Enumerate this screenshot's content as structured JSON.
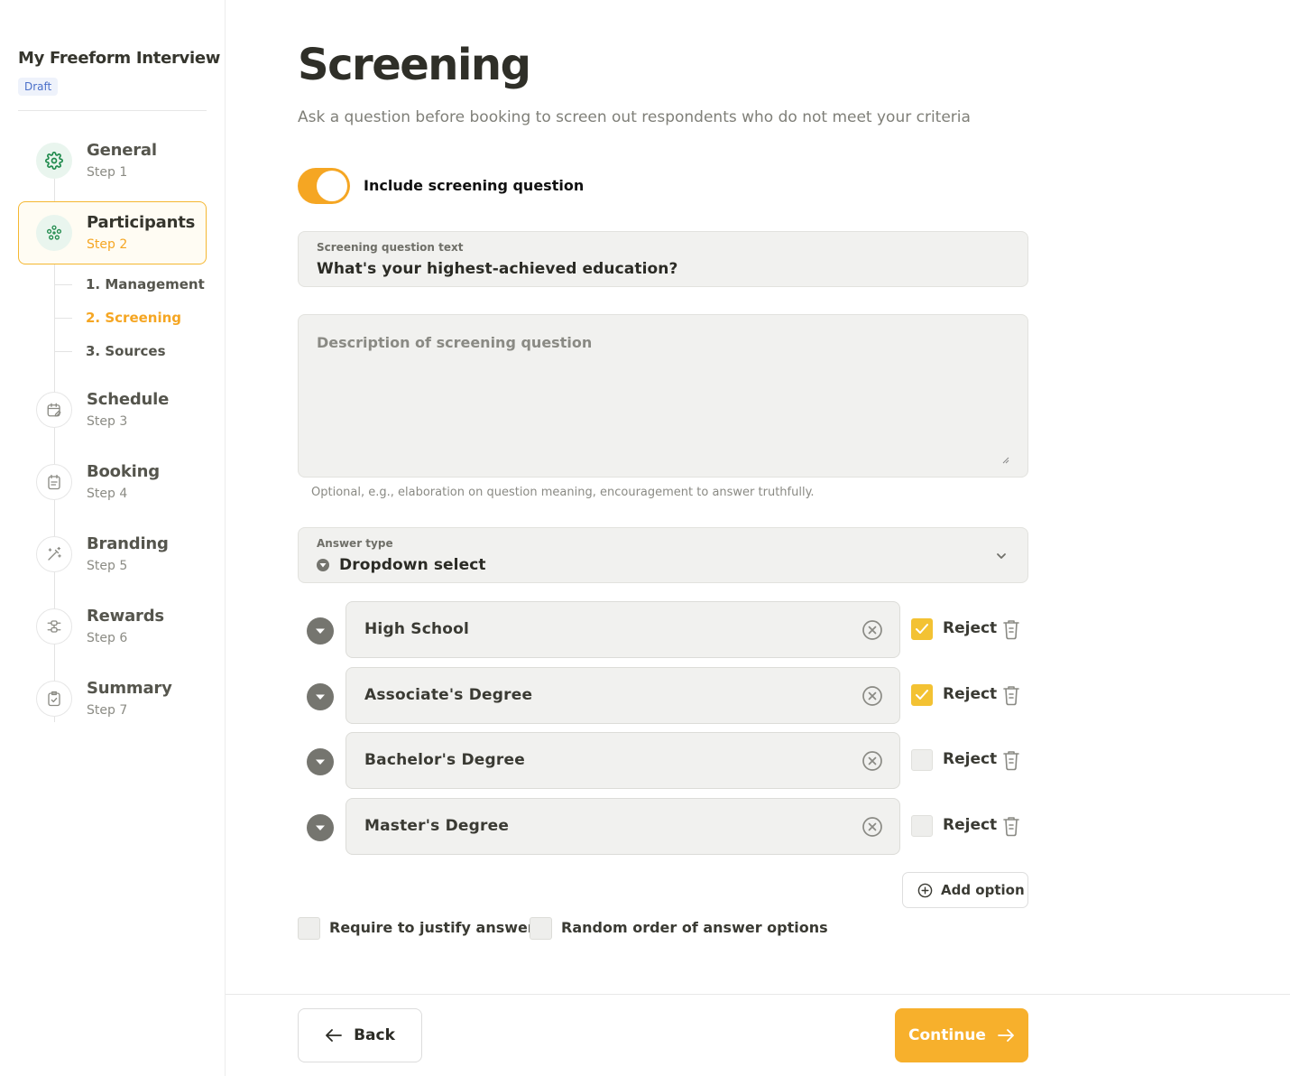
{
  "sidebar": {
    "project_title": "My Freeform Interview",
    "status_badge": "Draft",
    "steps": [
      {
        "title": "General",
        "sub": "Step 1",
        "icon": "gear-icon"
      },
      {
        "title": "Participants",
        "sub": "Step 2",
        "icon": "participants-icon"
      },
      {
        "title": "Schedule",
        "sub": "Step 3",
        "icon": "calendar-edit-icon"
      },
      {
        "title": "Booking",
        "sub": "Step 4",
        "icon": "calendar-list-icon"
      },
      {
        "title": "Branding",
        "sub": "Step 5",
        "icon": "magic-wand-icon"
      },
      {
        "title": "Rewards",
        "sub": "Step 6",
        "icon": "sliders-icon"
      },
      {
        "title": "Summary",
        "sub": "Step 7",
        "icon": "clipboard-check-icon"
      }
    ],
    "substeps": [
      "1. Management",
      "2. Screening",
      "3. Sources"
    ]
  },
  "main": {
    "title": "Screening",
    "subtitle": "Ask a question before booking to screen out respondents who do not meet your criteria",
    "toggle_label": "Include screening question",
    "toggle_on": true,
    "question": {
      "label": "Screening question text",
      "value": "What's your highest-achieved education?"
    },
    "description": {
      "placeholder": "Description of screening question",
      "helper": "Optional, e.g., elaboration on question meaning, encouragement to answer truthfully."
    },
    "answer_type": {
      "label": "Answer type",
      "value": "Dropdown select"
    },
    "options": [
      {
        "text": "High School",
        "reject": true
      },
      {
        "text": "Associate's Degree",
        "reject": true
      },
      {
        "text": "Bachelor's Degree",
        "reject": false
      },
      {
        "text": "Master's Degree",
        "reject": false
      }
    ],
    "reject_label": "Reject",
    "add_option": "Add option",
    "require_justify": "Require to justify answer",
    "random_order": "Random order of answer options"
  },
  "footer": {
    "back": "Back",
    "continue": "Continue"
  },
  "colors": {
    "accent": "#f5a623",
    "check": "#f3c233",
    "done_step": "#1f8a4c"
  }
}
